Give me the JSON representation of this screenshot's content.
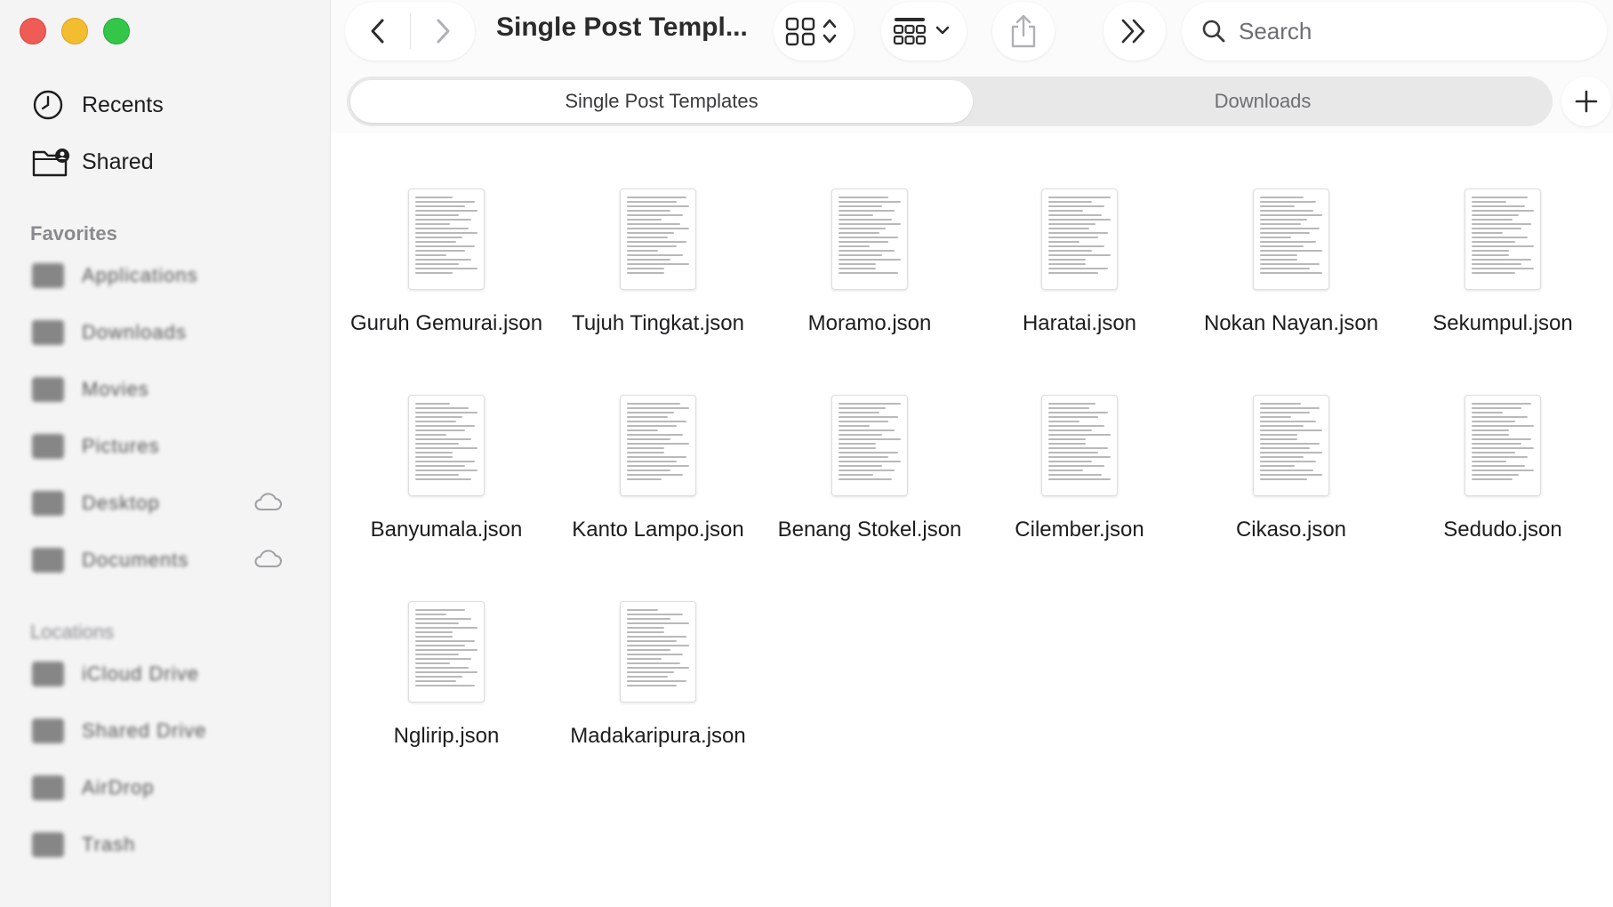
{
  "window": {
    "title": "Single Post Templ..."
  },
  "sidebar": {
    "top_items": [
      {
        "label": "Recents",
        "icon": "clock-icon"
      },
      {
        "label": "Shared",
        "icon": "shared-folder-icon"
      }
    ],
    "favorites_header": "Favorites",
    "favorites": [
      {
        "label": "Applications",
        "icon": "applications-icon"
      },
      {
        "label": "Downloads",
        "icon": "downloads-icon"
      },
      {
        "label": "Movies",
        "icon": "movies-icon"
      },
      {
        "label": "Pictures",
        "icon": "pictures-icon"
      },
      {
        "label": "Desktop",
        "icon": "desktop-icon",
        "cloud": true
      },
      {
        "label": "Documents",
        "icon": "documents-icon",
        "cloud": true
      }
    ],
    "locations_header": "Locations",
    "locations": [
      {
        "label": "iCloud Drive",
        "icon": "icloud-icon"
      },
      {
        "label": "Shared Drive",
        "icon": "network-icon"
      },
      {
        "label": "AirDrop",
        "icon": "airdrop-icon"
      },
      {
        "label": "Trash",
        "icon": "trash-icon"
      }
    ]
  },
  "toolbar": {
    "search_placeholder": "Search"
  },
  "tabs": [
    {
      "label": "Single Post Templates",
      "active": true
    },
    {
      "label": "Downloads",
      "active": false
    }
  ],
  "files": [
    {
      "name": "Guruh Gemurai.json"
    },
    {
      "name": "Tujuh Tingkat.json"
    },
    {
      "name": "Moramo.json"
    },
    {
      "name": "Haratai.json"
    },
    {
      "name": "Nokan Nayan.json"
    },
    {
      "name": "Sekumpul.json"
    },
    {
      "name": "Banyumala.json"
    },
    {
      "name": "Kanto Lampo.json"
    },
    {
      "name": "Benang Stokel.json"
    },
    {
      "name": "Cilember.json"
    },
    {
      "name": "Cikaso.json"
    },
    {
      "name": "Sedudo.json"
    },
    {
      "name": "Nglirip.json"
    },
    {
      "name": "Madakaripura.json"
    }
  ],
  "colors": {
    "close": "#ee5c55",
    "minimize": "#f3bd30",
    "maximize": "#33c649"
  }
}
